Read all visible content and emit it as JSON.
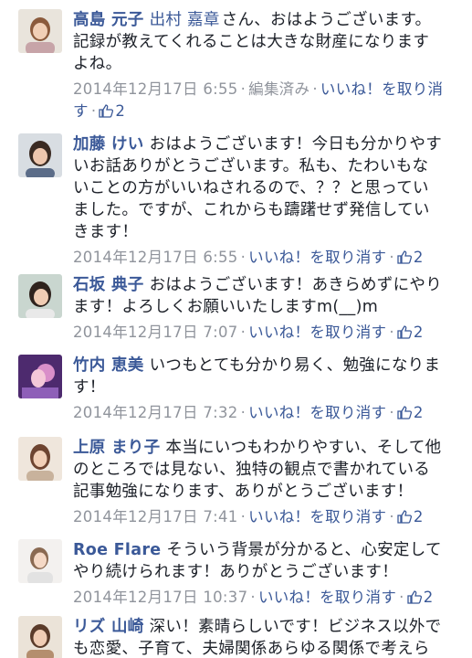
{
  "comments": [
    {
      "author": "高島 元子",
      "mention": "出村 嘉章",
      "text": "さん、おはようございます。記録が教えてくれることは大きな財産になりますよね。",
      "date": "2014年12月17日 6:55",
      "edited": "編集済み",
      "action": "いいね！を取り消す",
      "likes": "2"
    },
    {
      "author": "加藤 けい",
      "text": "おはようございます！今日も分かりやすいお話ありがとうございます。私も、たわいもないことの方がいいねされるので、？？と思っていました。ですが、これからも躊躇せず発信していきます！",
      "date": "2014年12月17日 6:55",
      "action": "いいね！を取り消す",
      "likes": "2"
    },
    {
      "author": "石坂 典子",
      "text": "おはようございます！あきらめずにやります！よろしくお願いいたしますm(__)m",
      "date": "2014年12月17日 7:07",
      "action": "いいね！を取り消す",
      "likes": "2"
    },
    {
      "author": "竹内 恵美",
      "text": "いつもとても分かり易く、勉強になります！",
      "date": "2014年12月17日 7:32",
      "action": "いいね！を取り消す",
      "likes": "2"
    },
    {
      "author": "上原 まり子",
      "text": "本当にいつもわかりやすい、そして他のところでは見ない、独特の観点で書かれている記事勉強になります、ありがとうございます！",
      "date": "2014年12月17日 7:41",
      "action": "いいね！を取り消す",
      "likes": "2"
    },
    {
      "author": "Roe Flare",
      "text": "そういう背景が分かると、心安定してやり続けられます！ありがとうございます！",
      "date": "2014年12月17日 10:37",
      "action": "いいね！を取り消す",
      "likes": "2"
    },
    {
      "author": "リズ 山崎",
      "text": "深い！素晴らしいです！ビジネス以外でも恋愛、子育て、夫婦関係あらゆる関係で考えられそうです。",
      "date": "",
      "action": "",
      "likes": ""
    }
  ],
  "colors": {
    "link": "#3b5998",
    "meta": "#90949c",
    "text": "#1d2129"
  },
  "icons": {
    "like": "thumbs-up-icon"
  }
}
